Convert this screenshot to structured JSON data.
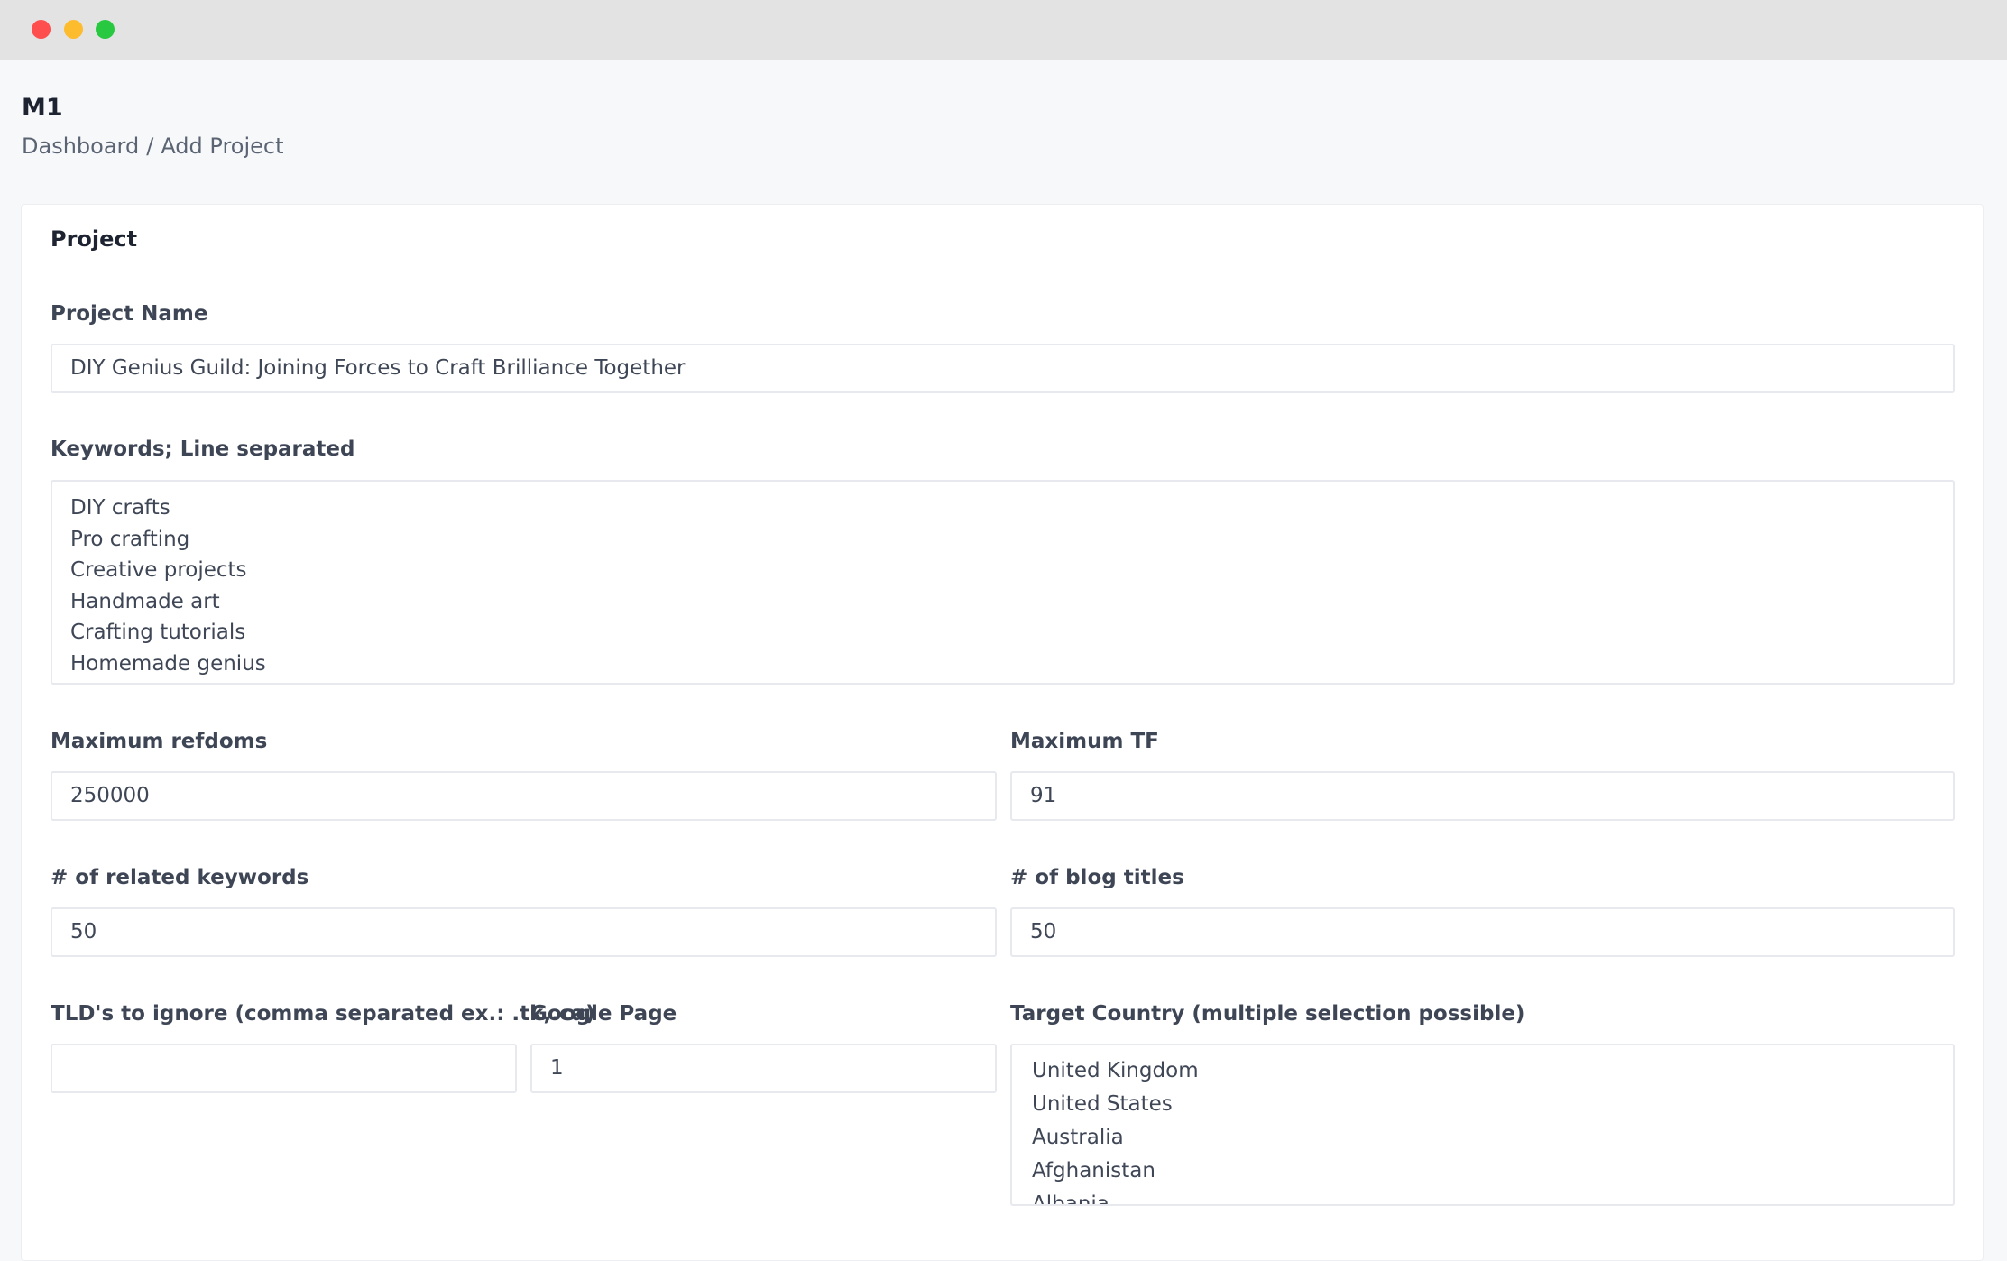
{
  "app": {
    "title": "M1"
  },
  "breadcrumb": {
    "items": [
      "Dashboard",
      "Add Project"
    ],
    "separator": "/"
  },
  "card": {
    "title": "Project"
  },
  "form": {
    "project_name": {
      "label": "Project Name",
      "value": "DIY Genius Guild: Joining Forces to Craft Brilliance Together"
    },
    "keywords": {
      "label": "Keywords; Line separated",
      "lines": [
        "DIY crafts",
        "Pro crafting",
        "Creative projects",
        "Handmade art",
        "Crafting tutorials",
        "Homemade genius"
      ]
    },
    "max_refdoms": {
      "label": "Maximum refdoms",
      "value": "250000"
    },
    "max_tf": {
      "label": "Maximum TF",
      "value": "91"
    },
    "related_keywords": {
      "label": "# of related keywords",
      "value": "50"
    },
    "blog_titles": {
      "label": "# of blog titles",
      "value": "50"
    },
    "tld_ignore": {
      "label": "TLD's to ignore (comma separated ex.: .tk,.ca)",
      "value": ""
    },
    "google_page": {
      "label": "Google Page",
      "value": "1"
    },
    "target_country": {
      "label": "Target Country (multiple selection possible)",
      "options": [
        "United Kingdom",
        "United States",
        "Australia",
        "Afghanistan",
        "Albania"
      ]
    }
  },
  "colors": {
    "window_dot_red": "#fe4e4e",
    "window_dot_yellow": "#fdbc2e",
    "window_dot_green": "#28c941",
    "page_background": "#f7f8fa",
    "card_background": "#ffffff",
    "field_border": "#e7e9ee"
  }
}
